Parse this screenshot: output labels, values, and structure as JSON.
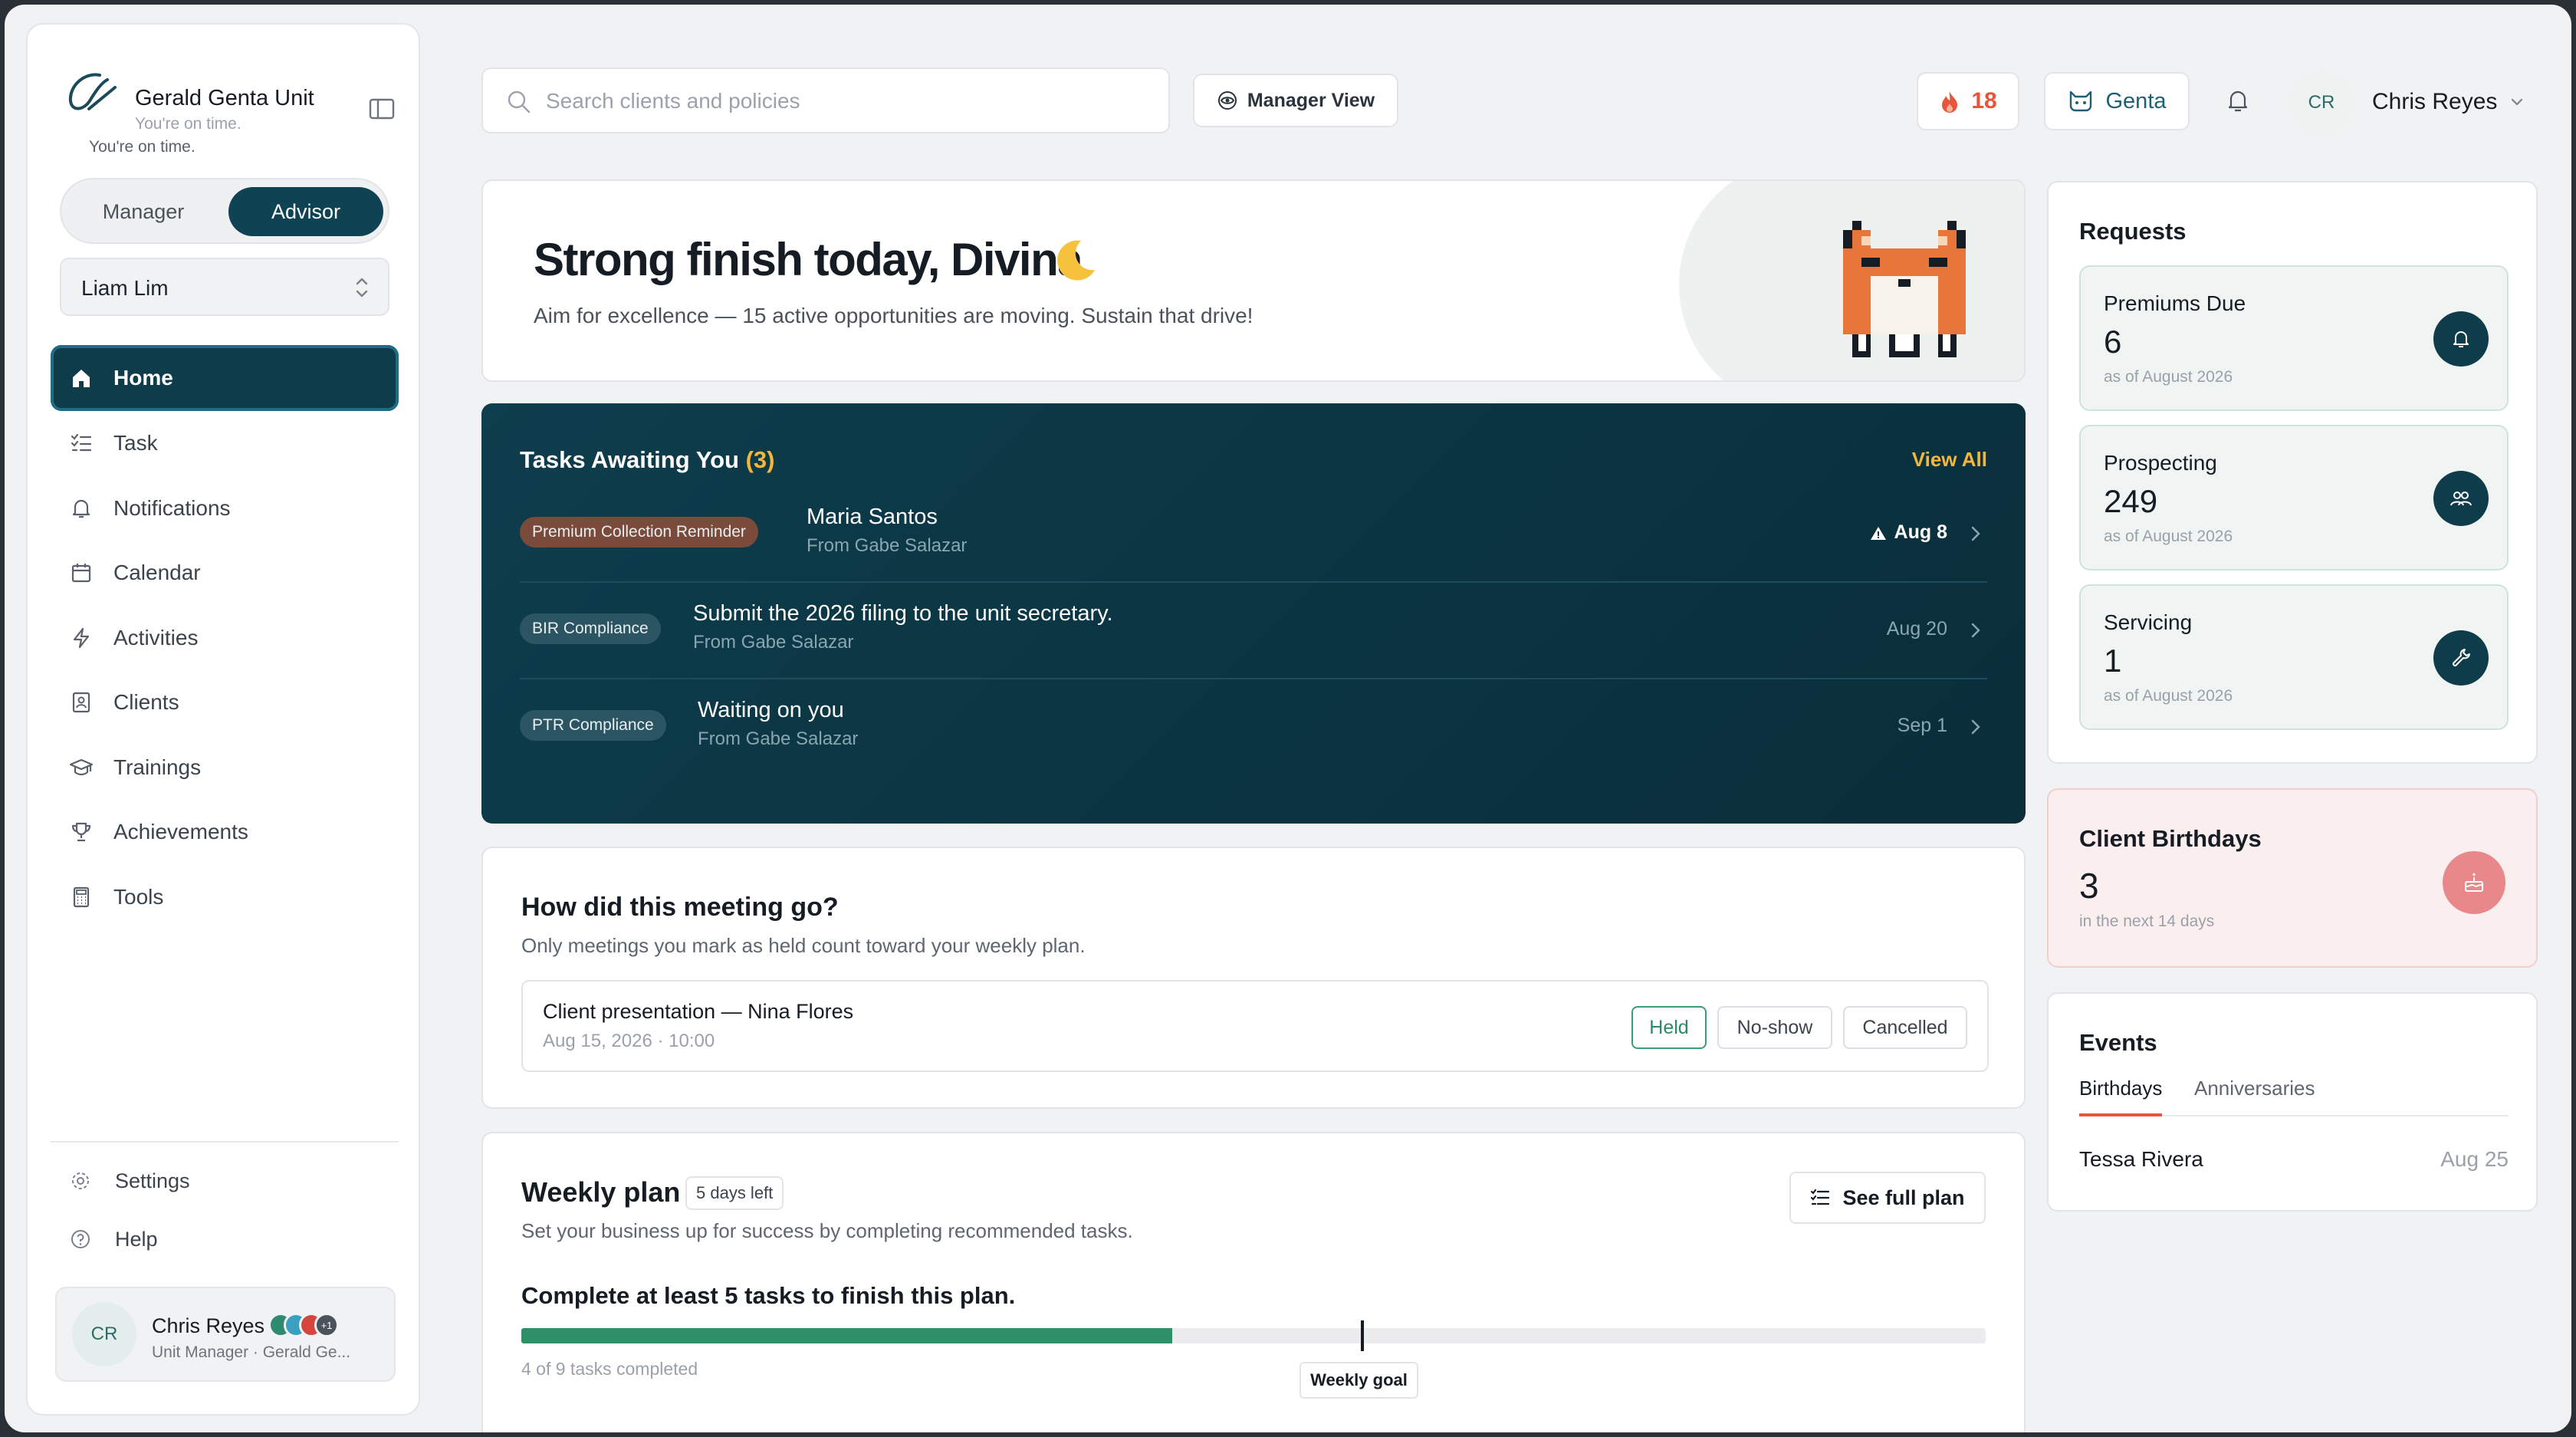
{
  "sidebar": {
    "brand": {
      "name": "Gerald Genta Unit",
      "subtitle": "You're on time.",
      "status": "You're on time."
    },
    "role_toggle": {
      "manager_label": "Manager",
      "advisor_label": "Advisor",
      "selected": "Advisor"
    },
    "advisor_select": {
      "value": "Liam Lim"
    },
    "nav": [
      {
        "label": "Home",
        "icon": "home-icon",
        "active": true
      },
      {
        "label": "Task",
        "icon": "checklist-icon"
      },
      {
        "label": "Notifications",
        "icon": "bell-icon"
      },
      {
        "label": "Calendar",
        "icon": "calendar-icon"
      },
      {
        "label": "Activities",
        "icon": "lightning-icon"
      },
      {
        "label": "Clients",
        "icon": "contact-book-icon"
      },
      {
        "label": "Trainings",
        "icon": "graduation-cap-icon"
      },
      {
        "label": "Achievements",
        "icon": "trophy-icon"
      },
      {
        "label": "Tools",
        "icon": "calculator-icon"
      }
    ],
    "settings_label": "Settings",
    "help_label": "Help",
    "user": {
      "initials": "CR",
      "name": "Chris Reyes",
      "subtitle": "Unit Manager · Gerald Ge...",
      "extra_badges": "+1"
    }
  },
  "topbar": {
    "search_placeholder": "Search clients and policies",
    "manager_view_label": "Manager View",
    "streak_count": "18",
    "pet_name": "Genta",
    "user": {
      "initials": "CR",
      "name": "Chris Reyes"
    }
  },
  "hero": {
    "title": "Strong finish today, Divina",
    "subtitle": "Aim for excellence — 15 active opportunities are moving. Sustain that drive!"
  },
  "tasks": {
    "title": "Tasks Awaiting You",
    "count": "(3)",
    "view_all": "View All",
    "items": [
      {
        "tag": "Premium Collection Reminder",
        "title": "Maria Santos",
        "from": "From Gabe Salazar",
        "date": "Aug 8",
        "urgent": true
      },
      {
        "tag": "BIR Compliance",
        "title": "Submit the 2026 filing to the unit secretary.",
        "from": "From Gabe Salazar",
        "date": "Aug 20"
      },
      {
        "tag": "PTR Compliance",
        "title": "Waiting on you",
        "from": "From Gabe Salazar",
        "date": "Sep 1"
      }
    ]
  },
  "meeting": {
    "title": "How did this meeting go?",
    "subtitle": "Only meetings you mark as held count toward your weekly plan.",
    "item": {
      "title": "Client presentation — Nina Flores",
      "when": "Aug 15, 2026 · 10:00"
    },
    "buttons": {
      "held": "Held",
      "noshow": "No-show",
      "cancelled": "Cancelled"
    }
  },
  "weekly_plan": {
    "title": "Weekly plan",
    "days_left": "5 days left",
    "subtitle": "Set your business up for success by completing recommended tasks.",
    "see_full_plan": "See full plan",
    "goal_text": "Complete at least 5 tasks to finish this plan.",
    "completed": 4,
    "total": 9,
    "goal": 5,
    "progress_label": "4 of 9 tasks completed",
    "goal_label": "Weekly goal"
  },
  "requests": {
    "title": "Requests",
    "items": [
      {
        "label": "Premiums Due",
        "value": "6",
        "as_of": "as of August 2026",
        "icon": "bell-icon"
      },
      {
        "label": "Prospecting",
        "value": "249",
        "as_of": "as of August 2026",
        "icon": "users-icon"
      },
      {
        "label": "Servicing",
        "value": "1",
        "as_of": "as of August 2026",
        "icon": "wrench-icon"
      }
    ]
  },
  "birthdays": {
    "title": "Client Birthdays",
    "value": "3",
    "subtitle": "in the next 14 days",
    "icon": "cake-icon"
  },
  "events": {
    "title": "Events",
    "tabs": [
      "Birthdays",
      "Anniversaries"
    ],
    "active_tab": "Birthdays",
    "items": [
      {
        "name": "Tessa Rivera",
        "date": "Aug 25"
      }
    ]
  },
  "colors": {
    "primary": "#0f3c4b",
    "accent": "#f5b73a",
    "streak": "#e8553a",
    "success": "#2f8f68",
    "birthday": "#e8888a"
  }
}
